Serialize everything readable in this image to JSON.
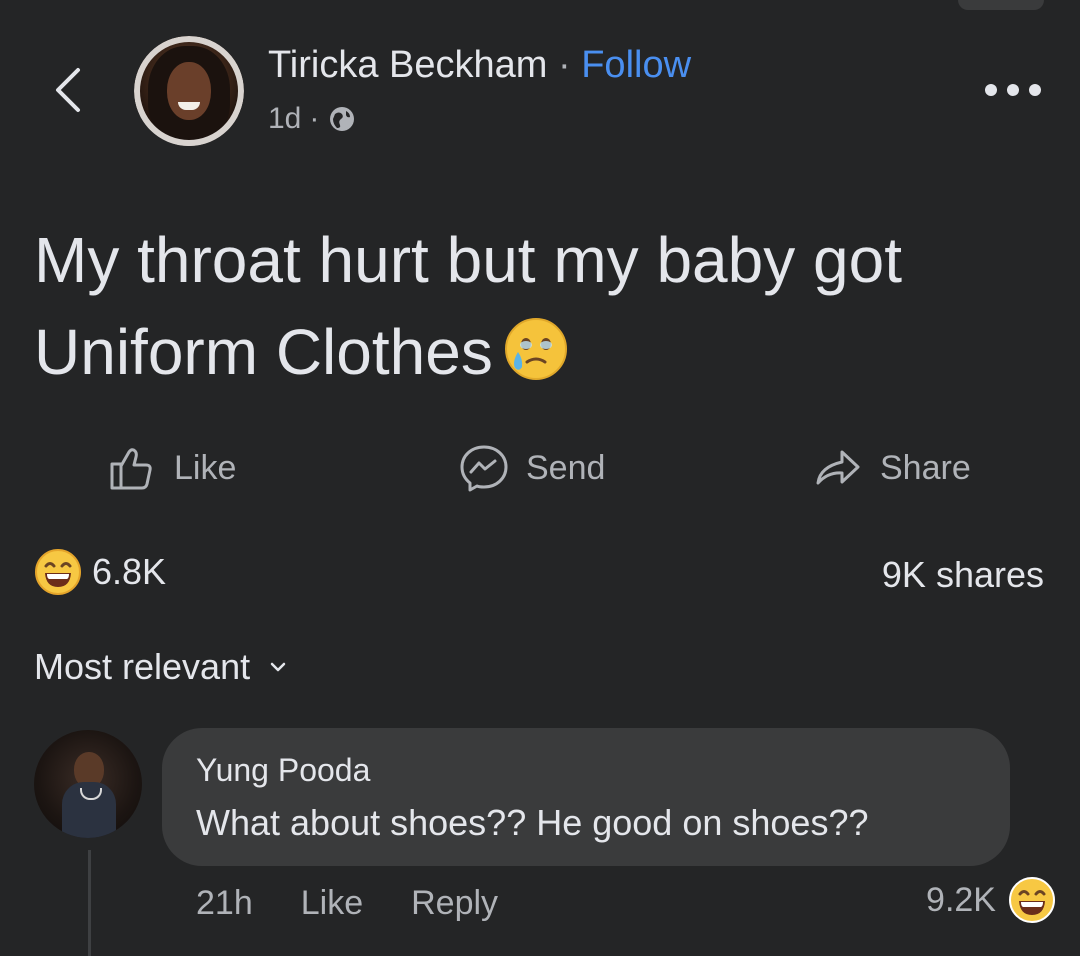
{
  "header": {
    "author": "Tiricka Beckham",
    "separator": " · ",
    "follow_label": "Follow",
    "time": "1d",
    "meta_separator": "·",
    "privacy_icon": "globe-icon"
  },
  "post": {
    "text": "My throat hurt but my baby got Uniform Clothes",
    "emoji": "face-holding-back-tears"
  },
  "actions": {
    "like": "Like",
    "send": "Send",
    "share": "Share"
  },
  "stats": {
    "reaction_icon": "laughing-emoji-icon",
    "reactions": "6.8K",
    "shares": "9K shares"
  },
  "sort": {
    "label": "Most relevant"
  },
  "comment": {
    "name": "Yung Pooda",
    "text": "What about shoes?? He good on shoes??",
    "time": "21h",
    "like": "Like",
    "reply": "Reply",
    "reactions": "9.2K",
    "reaction_icon": "laughing-emoji-icon"
  },
  "colors": {
    "background": "#242526",
    "text": "#e4e6eb",
    "secondary": "#b0b3b8",
    "link": "#4a8ff0",
    "bubble": "#3a3b3c"
  }
}
